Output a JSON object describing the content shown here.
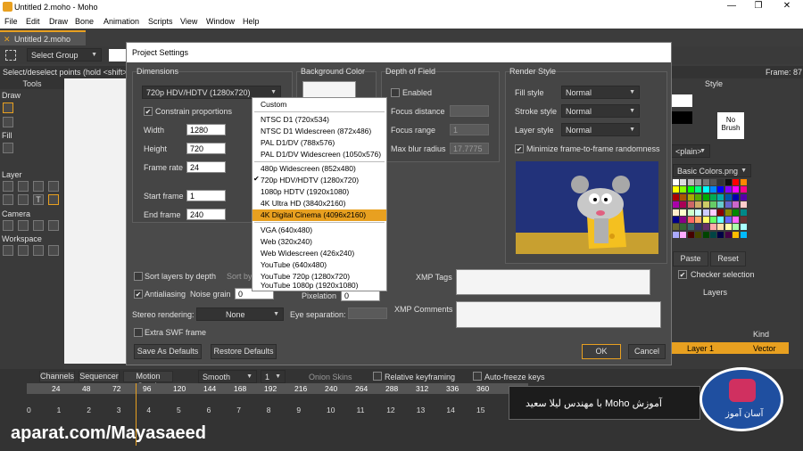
{
  "window": {
    "title": "Untitled 2.moho - Moho",
    "min": "—",
    "max": "❐",
    "close": "✕"
  },
  "menu": [
    "File",
    "Edit",
    "Draw",
    "Bone",
    "Animation",
    "Scripts",
    "View",
    "Window",
    "Help"
  ],
  "doc_tab": {
    "label": "Untitled 2.moho",
    "close": "✕"
  },
  "toolbar": {
    "select_group": "Select Group"
  },
  "status": {
    "hint": "Select/deselect points (hold <shift> to",
    "frame": "Frame: 87"
  },
  "tools_panel": {
    "title": "Tools",
    "sections": [
      "Draw",
      "Fill",
      "Layer",
      "Camera",
      "Workspace"
    ]
  },
  "dialog": {
    "title": "Project Settings",
    "dimensions": {
      "heading": "Dimensions",
      "preset": "720p HDV/HDTV (1280x720)",
      "constrain": "Constrain proportions",
      "width_label": "Width",
      "width": "1280",
      "height_label": "Height",
      "height": "720",
      "frame_rate_label": "Frame rate",
      "frame_rate": "24",
      "start_label": "Start frame",
      "start": "1",
      "end_label": "End frame",
      "end": "240"
    },
    "background": {
      "heading": "Background Color"
    },
    "dof": {
      "heading": "Depth of Field",
      "enabled": "Enabled",
      "focus_distance": "Focus distance",
      "focus_range": "Focus range",
      "max_blur": "Max blur radius",
      "fd_val": "",
      "fr_val": "1",
      "mb_val": "17.7775"
    },
    "render": {
      "heading": "Render Style",
      "fill_label": "Fill style",
      "fill": "Normal",
      "stroke_label": "Stroke style",
      "stroke": "Normal",
      "layer_label": "Layer style",
      "layer": "Normal",
      "minimize": "Minimize frame-to-frame randomness"
    },
    "sort_depth": "Sort layers by depth",
    "sort_by": "Sort by",
    "antialiasing": "Antialiasing",
    "noise_grain": "Noise grain",
    "noise_val": "0",
    "pixelation": "Pixelation",
    "pix_val": "0",
    "stereo_label": "Stereo rendering:",
    "stereo": "None",
    "eye_sep": "Eye separation:",
    "extra_swf": "Extra SWF frame",
    "xmp_tags": "XMP Tags",
    "xmp_comments": "XMP Comments",
    "save_defaults": "Save As Defaults",
    "restore_defaults": "Restore Defaults",
    "ok": "OK",
    "cancel": "Cancel"
  },
  "dropdown": {
    "items": [
      "Custom",
      "NTSC D1 (720x534)",
      "NTSC D1 Widescreen (872x486)",
      "PAL D1/DV (788x576)",
      "PAL D1/DV Widescreen (1050x576)",
      "480p Widescreen (852x480)",
      "720p HDV/HDTV (1280x720)",
      "1080p HDTV (1920x1080)",
      "4K Ultra HD (3840x2160)",
      "4K Digital Cinema (4096x2160)",
      "VGA (640x480)",
      "Web (320x240)",
      "Web Widescreen (426x240)",
      "YouTube (640x480)",
      "YouTube 720p (1280x720)",
      "YouTube 1080p (1920x1080)"
    ],
    "checked": "✔",
    "highlight_color": "#e8a020"
  },
  "style_panel": {
    "title": "Style",
    "no_brush": "No Brush",
    "plain": "<plain>",
    "palette": "Basic Colors.png",
    "paste": "Paste",
    "reset": "Reset",
    "checker": "Checker selection"
  },
  "layers_panel": {
    "title": "Layers",
    "col_name": "Name",
    "col_kind": "Kind",
    "layer_name": "Layer 1",
    "layer_kind": "Vector"
  },
  "timeline": {
    "tabs": [
      "Channels",
      "Sequencer",
      "Motion Graph"
    ],
    "interp": "Smooth",
    "step": "1",
    "onion": "Onion Skins",
    "relative": "Relative keyframing",
    "autofreeze": "Auto-freeze keys",
    "ruler": [
      "24",
      "48",
      "72",
      "96",
      "120",
      "144",
      "168",
      "192",
      "216",
      "240",
      "264",
      "288",
      "312",
      "336",
      "360"
    ],
    "ruler2": [
      "0",
      "1",
      "2",
      "3",
      "4",
      "5",
      "6",
      "7",
      "8",
      "9",
      "10",
      "11",
      "12",
      "13",
      "14",
      "15"
    ]
  },
  "watermark": {
    "text": "aparat.com/Mayasaeed",
    "banner_line1": "آموزش  Moho  با مهندس لیلا سعید",
    "logo_caption": "آسان آموز"
  }
}
